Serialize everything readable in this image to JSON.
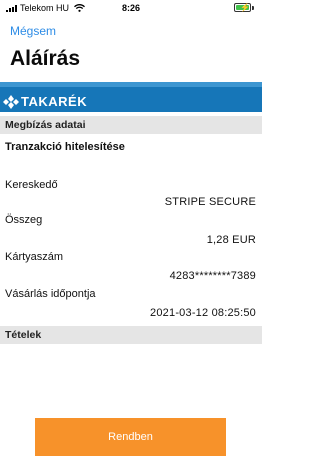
{
  "status_bar": {
    "carrier": "Telekom HU",
    "time": "8:26"
  },
  "nav": {
    "back_label": "Mégsem",
    "title": "Aláírás"
  },
  "bank": {
    "logo_text": "TAKARÉK",
    "brand_color": "#1676b8"
  },
  "order_section": {
    "header": "Megbízás adatai",
    "subtitle": "Tranzakció hitelesítése",
    "fields": [
      {
        "label": "Kereskedő",
        "value": "STRIPE SECURE"
      },
      {
        "label": "Összeg",
        "value": "1,28 EUR"
      },
      {
        "label": "Kártyaszám",
        "value": "4283********7389"
      },
      {
        "label": "Vásárlás időpontja",
        "value": "2021-03-12 08:25:50"
      }
    ]
  },
  "items_section": {
    "header": "Tételek"
  },
  "footer": {
    "ok_label": "Rendben",
    "ok_color": "#f7922a"
  }
}
